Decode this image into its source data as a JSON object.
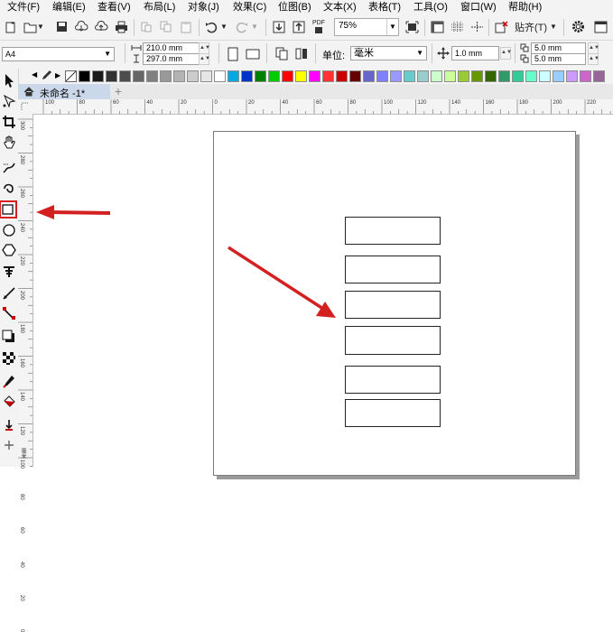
{
  "menu": [
    {
      "key": "file",
      "label": "文件(F)"
    },
    {
      "key": "edit",
      "label": "编辑(E)"
    },
    {
      "key": "view",
      "label": "查看(V)"
    },
    {
      "key": "layout",
      "label": "布局(L)"
    },
    {
      "key": "object",
      "label": "对象(J)"
    },
    {
      "key": "effects",
      "label": "效果(C)"
    },
    {
      "key": "bitmaps",
      "label": "位图(B)"
    },
    {
      "key": "text",
      "label": "文本(X)"
    },
    {
      "key": "table",
      "label": "表格(T)"
    },
    {
      "key": "tools",
      "label": "工具(O)"
    },
    {
      "key": "window",
      "label": "窗口(W)"
    },
    {
      "key": "help",
      "label": "帮助(H)"
    }
  ],
  "toolbar": {
    "pdf_label": "PDF",
    "zoom_value": "75%",
    "snap_label": "贴齐(T)"
  },
  "property_bar": {
    "page_size": "A4",
    "width": "210.0 mm",
    "height": "297.0 mm",
    "units_label": "单位:",
    "units_value": "毫米",
    "nudge": "1.0 mm",
    "dup_x": "5.0 mm",
    "dup_y": "5.0 mm"
  },
  "palette": {
    "colors": [
      "#000000",
      "#1a1a1a",
      "#333333",
      "#4d4d4d",
      "#666666",
      "#808080",
      "#999999",
      "#b3b3b3",
      "#cccccc",
      "#e6e6e6",
      "#ffffff",
      "#00a9e0",
      "#0033cc",
      "#008000",
      "#00cc00",
      "#ff0000",
      "#ffff00",
      "#ff00ff",
      "#ff3333",
      "#cc0000",
      "#660000",
      "#6666cc",
      "#8080ff",
      "#9999ff",
      "#66cccc",
      "#99cccc",
      "#ccffcc",
      "#ccff99",
      "#99cc33",
      "#669900",
      "#336600",
      "#339966",
      "#33cc99",
      "#66ffcc",
      "#ccffff",
      "#99ccff",
      "#cc99ff",
      "#cc66cc",
      "#996699"
    ]
  },
  "document_tab": {
    "title": "未命名 -1*",
    "add_label": "+"
  },
  "rulers": {
    "horizontal_labels": [
      "100",
      "80",
      "60",
      "40",
      "20",
      "0",
      "20",
      "40",
      "60",
      "80",
      "100",
      "120",
      "140",
      "160",
      "180",
      "200",
      "220"
    ],
    "vertical_labels": [
      "300",
      "280",
      "260",
      "240",
      "220",
      "200",
      "180",
      "160",
      "140",
      "120",
      "100",
      "80",
      "60",
      "40",
      "20",
      "0"
    ],
    "unit_label": "毫米"
  },
  "toolbox": {
    "tools": [
      "pick",
      "shape",
      "crop",
      "pan",
      "freehand",
      "smart-draw",
      "rectangle",
      "ellipse",
      "polygon",
      "text",
      "parallel-dimension",
      "connector",
      "drop-shadow",
      "transparency",
      "color-eyedropper",
      "interactive-fill",
      "smart-fill",
      "add"
    ]
  },
  "canvas": {
    "rectangle_count": 6
  },
  "annotations": {
    "highlight_color": "#d42020"
  }
}
